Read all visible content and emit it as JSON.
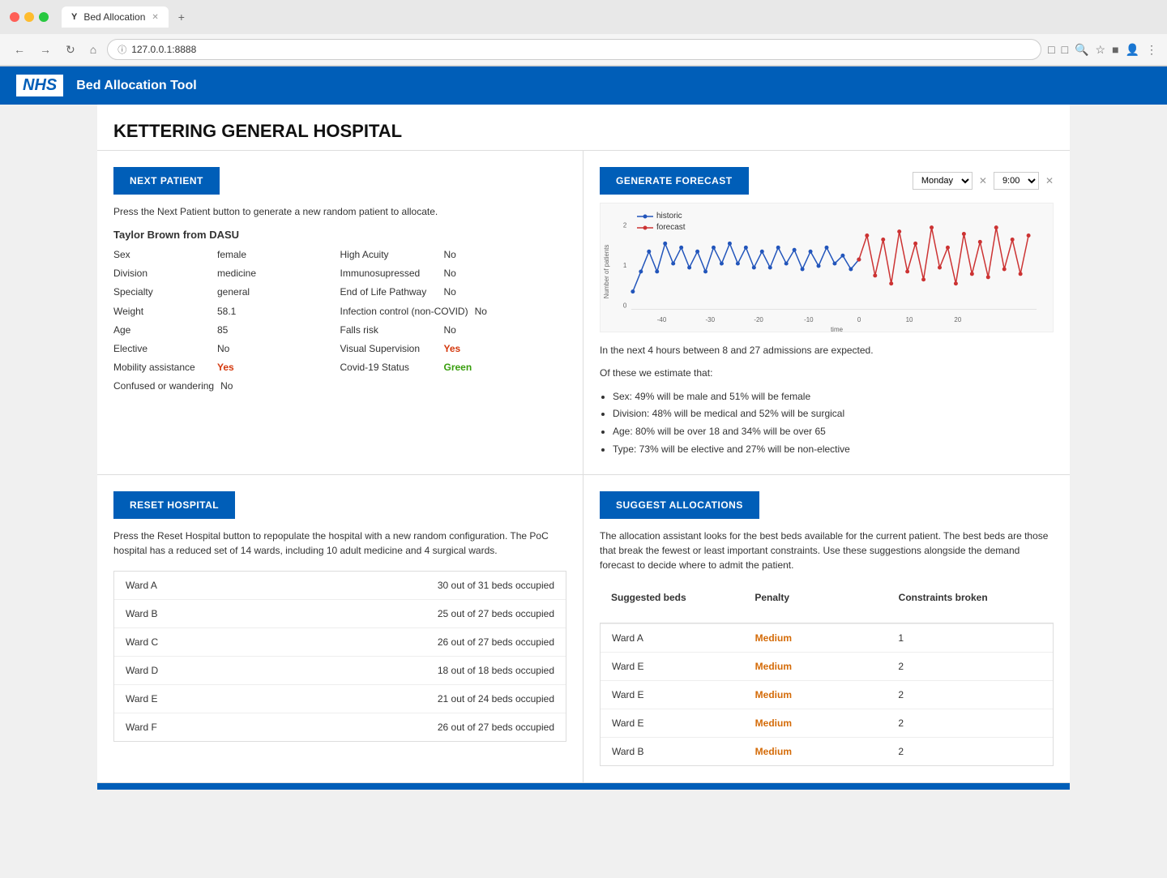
{
  "browser": {
    "dots": [
      "red",
      "yellow",
      "green"
    ],
    "tab_title": "Bed Allocation",
    "tab_favicon": "Y",
    "url": "127.0.0.1:8888",
    "new_tab_label": "+"
  },
  "nhs": {
    "logo": "NHS",
    "title": "Bed Allocation Tool"
  },
  "page": {
    "hospital_name": "KETTERING GENERAL HOSPITAL"
  },
  "left_top": {
    "button_label": "NEXT PATIENT",
    "description": "Press the Next Patient button to generate a new random patient to allocate.",
    "patient_name": "Taylor Brown from DASU",
    "details_left": [
      {
        "label": "Sex",
        "value": "female",
        "style": "normal"
      },
      {
        "label": "Division",
        "value": "medicine",
        "style": "normal"
      },
      {
        "label": "Specialty",
        "value": "general",
        "style": "normal"
      },
      {
        "label": "Weight",
        "value": "58.1",
        "style": "normal"
      },
      {
        "label": "Age",
        "value": "85",
        "style": "normal"
      },
      {
        "label": "Elective",
        "value": "No",
        "style": "normal"
      },
      {
        "label": "Mobility assistance",
        "value": "Yes",
        "style": "red"
      },
      {
        "label": "Confused or wandering",
        "value": "No",
        "style": "normal"
      }
    ],
    "details_right": [
      {
        "label": "High Acuity",
        "value": "No",
        "style": "normal"
      },
      {
        "label": "Immunosupressed",
        "value": "No",
        "style": "normal"
      },
      {
        "label": "End of Life Pathway",
        "value": "No",
        "style": "normal"
      },
      {
        "label": "Infection control (non-COVID)",
        "value": "No",
        "style": "normal"
      },
      {
        "label": "Falls risk",
        "value": "No",
        "style": "normal"
      },
      {
        "label": "Visual Supervision",
        "value": "Yes",
        "style": "red"
      },
      {
        "label": "Covid-19 Status",
        "value": "Green",
        "style": "green"
      }
    ]
  },
  "right_top": {
    "button_label": "GENERATE FORECAST",
    "day_select": "Monday",
    "time_select": "9:00",
    "legend": [
      {
        "label": "historic",
        "color": "#2255bb"
      },
      {
        "label": "forecast",
        "color": "#cc3333"
      }
    ],
    "chart": {
      "y_label": "Number of patients",
      "x_label": "time",
      "x_ticks": [
        "-40",
        "-30",
        "-20",
        "-10",
        "0",
        "10",
        "20"
      ]
    },
    "forecast_intro": "In the next 4 hours between 8 and 27 admissions are expected.",
    "forecast_sub": "Of these we estimate that:",
    "forecast_items": [
      "Sex: 49% will be male and 51% will be female",
      "Division: 48% will be medical and 52% will be surgical",
      "Age: 80% will be over 18 and 34% will be over 65",
      "Type: 73% will be elective and 27% will be non-elective"
    ]
  },
  "left_bottom": {
    "button_label": "RESET HOSPITAL",
    "description": "Press the Reset Hospital button to repopulate the hospital with a new random configuration. The PoC hospital has a reduced set of 14 wards, including 10 adult medicine and 4 surgical wards.",
    "wards": [
      {
        "name": "Ward A",
        "occupancy": "30 out of 31 beds occupied"
      },
      {
        "name": "Ward B",
        "occupancy": "25 out of 27 beds occupied"
      },
      {
        "name": "Ward C",
        "occupancy": "26 out of 27 beds occupied"
      },
      {
        "name": "Ward D",
        "occupancy": "18 out of 18 beds occupied"
      },
      {
        "name": "Ward E",
        "occupancy": "21 out of 24 beds occupied"
      },
      {
        "name": "Ward F",
        "occupancy": "26 out of 27 beds occupied"
      }
    ]
  },
  "right_bottom": {
    "button_label": "SUGGEST ALLOCATIONS",
    "description": "The allocation assistant looks for the best beds available for the current patient. The best beds are those that break the fewest or least important constraints. Use these suggestions alongside the demand forecast to decide where to admit the patient.",
    "table_headers": [
      "Suggested beds",
      "Penalty",
      "Constraints broken"
    ],
    "suggestions": [
      {
        "ward": "Ward A",
        "penalty": "Medium",
        "constraints": "1"
      },
      {
        "ward": "Ward E",
        "penalty": "Medium",
        "constraints": "2"
      },
      {
        "ward": "Ward E",
        "penalty": "Medium",
        "constraints": "2"
      },
      {
        "ward": "Ward E",
        "penalty": "Medium",
        "constraints": "2"
      },
      {
        "ward": "Ward B",
        "penalty": "Medium",
        "constraints": "2"
      }
    ]
  }
}
